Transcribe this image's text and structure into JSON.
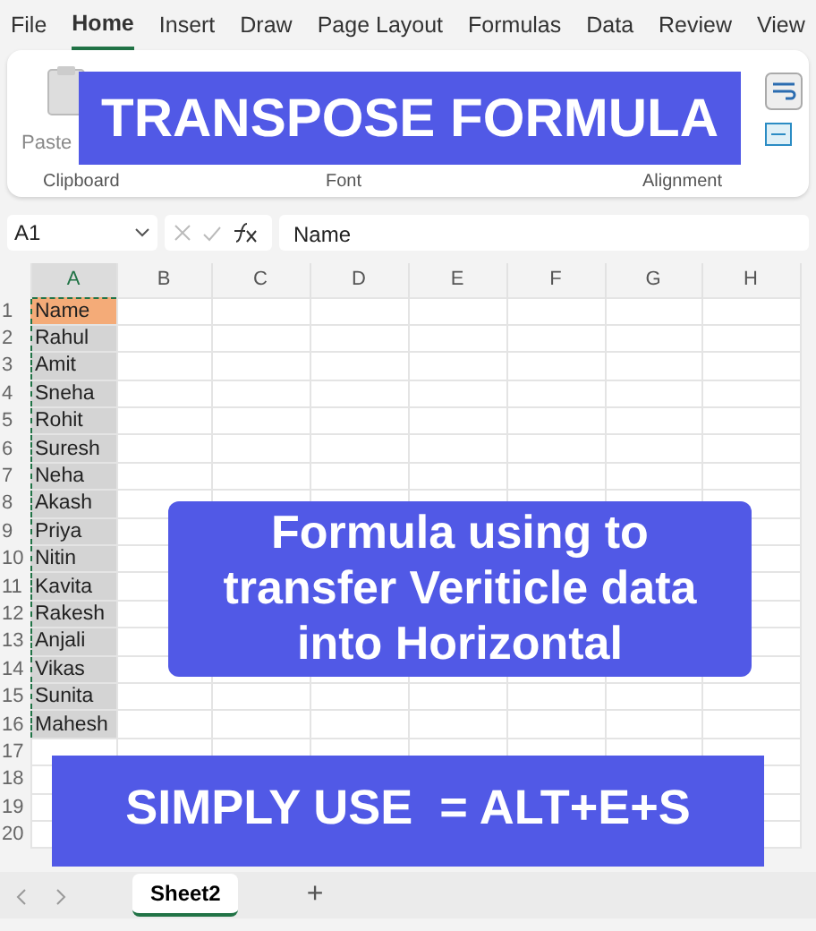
{
  "ribbon_tabs": [
    {
      "label": "File",
      "selected": false
    },
    {
      "label": "Home",
      "selected": true
    },
    {
      "label": "Insert",
      "selected": false
    },
    {
      "label": "Draw",
      "selected": false
    },
    {
      "label": "Page Layout",
      "selected": false
    },
    {
      "label": "Formulas",
      "selected": false
    },
    {
      "label": "Data",
      "selected": false
    },
    {
      "label": "Review",
      "selected": false
    },
    {
      "label": "View",
      "selected": false
    }
  ],
  "ribbon": {
    "paste_label": "Paste",
    "groups": [
      "Clipboard",
      "Font",
      "Alignment"
    ]
  },
  "formula_bar": {
    "name_box": "A1",
    "content": "Name"
  },
  "columns": [
    {
      "label": "A",
      "selected": true
    },
    {
      "label": "B",
      "selected": false
    },
    {
      "label": "C",
      "selected": false
    },
    {
      "label": "D",
      "selected": false
    },
    {
      "label": "E",
      "selected": false
    },
    {
      "label": "F",
      "selected": false
    },
    {
      "label": "G",
      "selected": false
    },
    {
      "label": "H",
      "selected": false
    }
  ],
  "rows": [
    {
      "number": "1",
      "a": "Name",
      "copied": true,
      "active": true
    },
    {
      "number": "2",
      "a": "Rahul",
      "copied": true,
      "active": false
    },
    {
      "number": "3",
      "a": "Amit",
      "copied": true,
      "active": false
    },
    {
      "number": "4",
      "a": "Sneha",
      "copied": true,
      "active": false
    },
    {
      "number": "5",
      "a": "Rohit",
      "copied": true,
      "active": false
    },
    {
      "number": "6",
      "a": "Suresh",
      "copied": true,
      "active": false
    },
    {
      "number": "7",
      "a": "Neha",
      "copied": true,
      "active": false
    },
    {
      "number": "8",
      "a": "Akash",
      "copied": true,
      "active": false
    },
    {
      "number": "9",
      "a": "Priya",
      "copied": true,
      "active": false
    },
    {
      "number": "10",
      "a": "Nitin",
      "copied": true,
      "active": false
    },
    {
      "number": "11",
      "a": "Kavita",
      "copied": true,
      "active": false
    },
    {
      "number": "12",
      "a": "Rakesh",
      "copied": true,
      "active": false
    },
    {
      "number": "13",
      "a": "Anjali",
      "copied": true,
      "active": false
    },
    {
      "number": "14",
      "a": "Vikas",
      "copied": true,
      "active": false
    },
    {
      "number": "15",
      "a": "Sunita",
      "copied": true,
      "active": false
    },
    {
      "number": "16",
      "a": "Mahesh",
      "copied": true,
      "active": false
    },
    {
      "number": "17",
      "copied": false,
      "active": false
    },
    {
      "number": "18",
      "copied": false,
      "active": false
    },
    {
      "number": "19",
      "copied": false,
      "active": false
    },
    {
      "number": "20",
      "copied": false,
      "active": false
    }
  ],
  "sheet_tabs": [
    {
      "label": "Sheet2",
      "selected": true
    }
  ],
  "add_sheet": "+",
  "captions": [
    {
      "kind": "title",
      "text": "TRANSPOSE FORMULA"
    },
    {
      "kind": "body",
      "text": "Formula using to transfer Veriticle data into Horizontal"
    },
    {
      "kind": "shortcut",
      "text": "SIMPLY USE  = ALT+E+S"
    }
  ]
}
